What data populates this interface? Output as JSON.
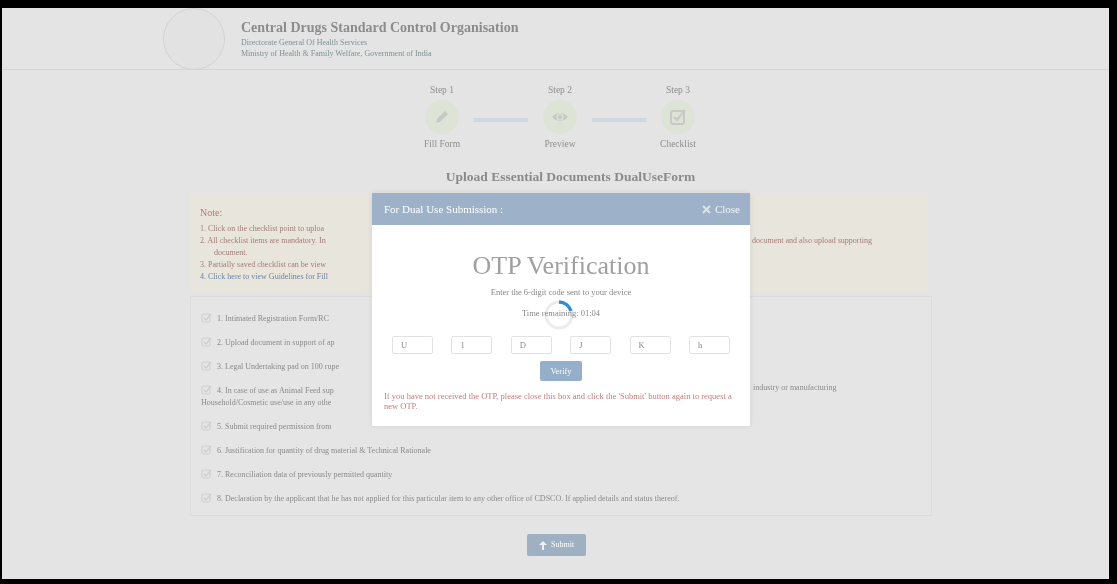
{
  "header": {
    "title": "Central Drugs Standard Control Organisation",
    "lines": [
      "Directorate General Of Health Services",
      "Ministry of Health & Family Welfare, Government of India"
    ]
  },
  "steps": [
    {
      "step": "Step 1",
      "label": "Fill Form",
      "kind": "pencil"
    },
    {
      "step": "Step 2",
      "label": "Preview",
      "kind": "eye"
    },
    {
      "step": "Step 3",
      "label": "Checklist",
      "kind": "check"
    }
  ],
  "page_title": "Upload Essential Documents DualUseForm",
  "note": {
    "heading": "Note:",
    "items": [
      {
        "kind": "text",
        "text": "1. Click on the checklist point to uploa"
      },
      {
        "kind": "text",
        "text": "2. All checklist items are mandatory. In",
        "text_right": "document and also upload supporting",
        "continuation": "document."
      },
      {
        "kind": "text",
        "text": "3. Partially saved checklist can be view"
      },
      {
        "kind": "link",
        "text": "4. Click here to view Guidelines for Fill"
      }
    ]
  },
  "checklist": [
    {
      "text": "1. Intimated Registration Form/RC"
    },
    {
      "text": "2. Upload document in support of ap"
    },
    {
      "text": "3. Legal Undertaking pad on 100 rupe"
    },
    {
      "text": "4. In case of use as Animal Feed sup",
      "text_right": "industry or manufacturing",
      "continuation": "Household/Cosmetic use/use in any othe"
    },
    {
      "text": "5. Submit required permission from"
    },
    {
      "text": "6. Justification for quantity of drug material & Technical Rationale"
    },
    {
      "text": "7. Reconciliation data of previously permitted quantity"
    },
    {
      "text": "8. Declaration by the applicant that he has not applied for this particular item to any other office of CDSCO. If applied details and status thereof."
    }
  ],
  "submit_button": "Submit",
  "modal": {
    "title": "For Dual Use Submission :",
    "close": "Close",
    "heading": "OTP Verification",
    "instruction": "Enter the 6-digit code sent to your device",
    "timer": "Time remaining: 01:04",
    "otp_values": [
      "U",
      "1",
      "D",
      "J",
      "K",
      "h"
    ],
    "verify_button": "Verify",
    "help_text": "If you have not received the OTP, please close this box and click the 'Submit' button again to request a new OTP."
  }
}
